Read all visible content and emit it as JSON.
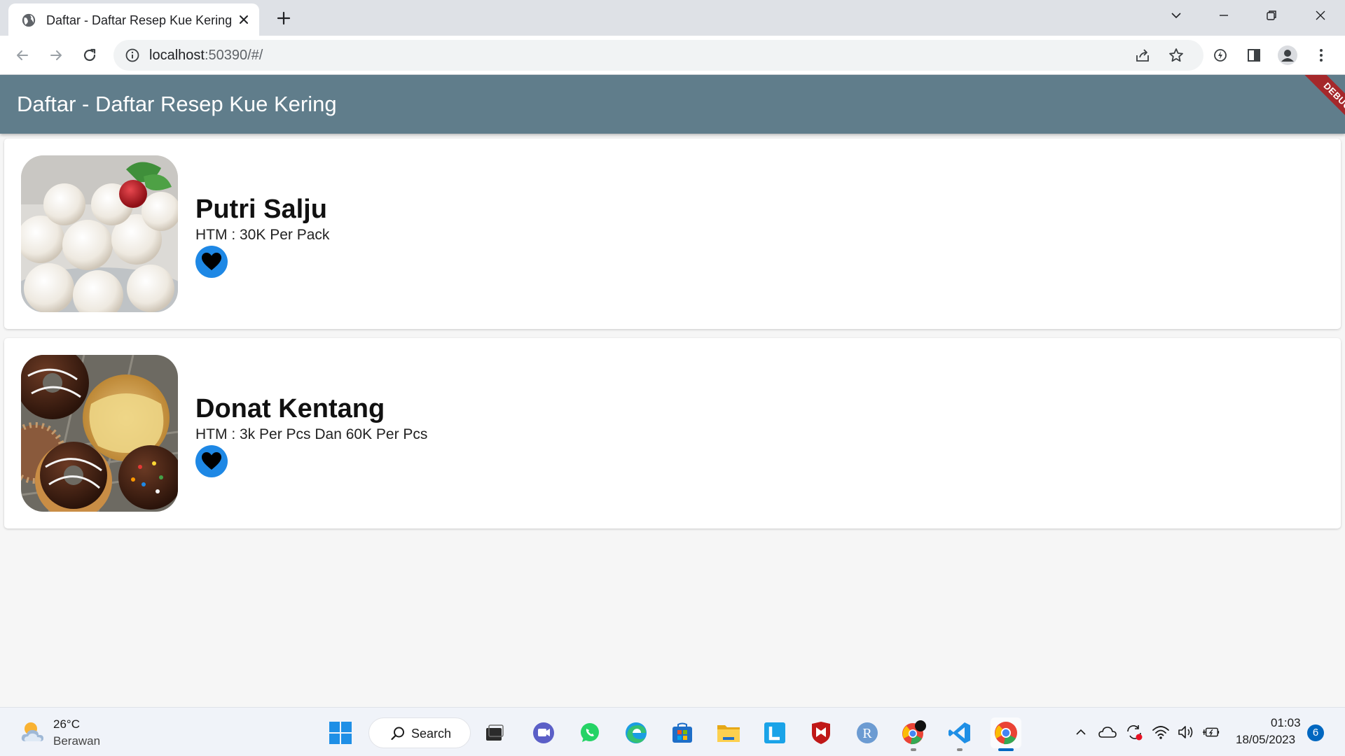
{
  "browser": {
    "tab_title": "Daftar - Daftar Resep Kue Kering",
    "url_host": "localhost",
    "url_rest": ":50390/#/"
  },
  "app": {
    "title": "Daftar - Daftar Resep Kue Kering",
    "debug_label": "DEBUG",
    "colors": {
      "appbar": "#607d8b",
      "fav_button": "#1e88e5",
      "debug_banner": "#a5282b"
    },
    "recipes": [
      {
        "name": "Putri Salju",
        "price": "HTM : 30K Per Pack",
        "image": "snowball-cookies-photo",
        "icon": "heart-icon"
      },
      {
        "name": "Donat Kentang",
        "price": "HTM : 3k Per Pcs Dan 60K Per Pcs",
        "image": "potato-donuts-photo",
        "icon": "heart-icon"
      }
    ]
  },
  "taskbar": {
    "weather_temp": "26°C",
    "weather_desc": "Berawan",
    "search_label": "Search",
    "clock_time": "01:03",
    "clock_date": "18/05/2023",
    "notification_count": "6",
    "apps": [
      "start",
      "search",
      "task-view",
      "teams-chat",
      "whatsapp",
      "edge",
      "microsoft-store",
      "file-explorer",
      "lens-app",
      "mcafee",
      "r-app",
      "chrome-profile",
      "vscode",
      "chrome"
    ]
  }
}
